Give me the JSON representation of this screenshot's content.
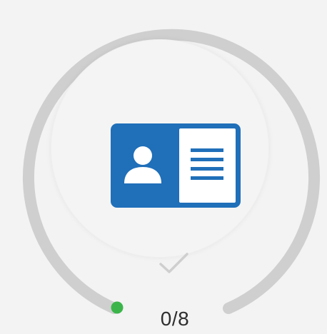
{
  "verification": {
    "progress_text": "0/8",
    "progress_fraction": 0,
    "steps_done": 0,
    "steps_total": 8
  },
  "icons": {
    "main": "id-card-icon",
    "status": "checkmark-icon",
    "progress_dot": "progress-dot"
  },
  "colors": {
    "background": "#f3f3f3",
    "ring_track": "#cfcfcf",
    "accent_blue": "#1f6fb9",
    "progress_dot": "#3bb54a",
    "checkmark": "#cfcfcf",
    "counter_text": "#2e2e2e"
  }
}
